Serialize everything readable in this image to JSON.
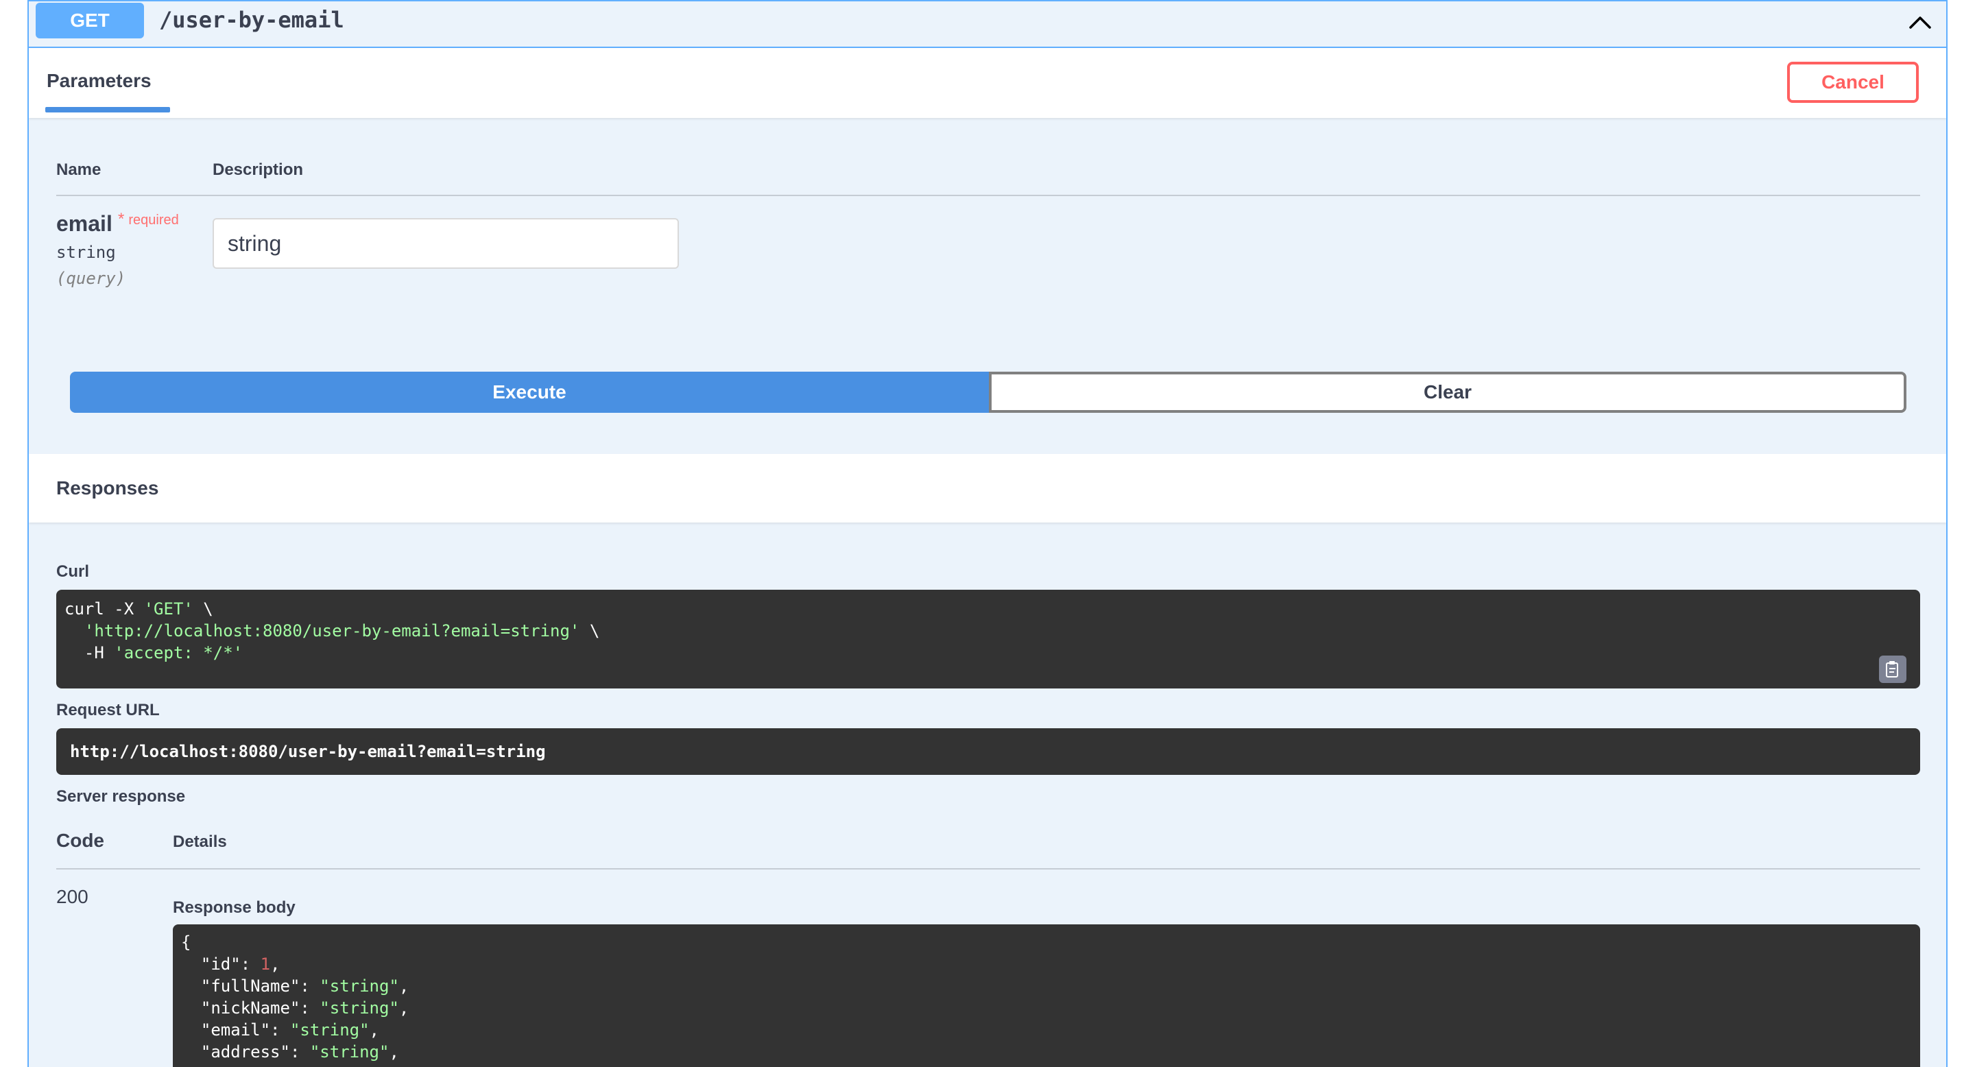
{
  "summary": {
    "method": "GET",
    "path": "/user-by-email",
    "collapse_icon": "chevron-up-icon"
  },
  "parameters": {
    "tab_label": "Parameters",
    "cancel_label": "Cancel",
    "col_name": "Name",
    "col_description": "Description",
    "param": {
      "name": "email",
      "required_mark": "*",
      "required_label": "required",
      "type": "string",
      "in": "(query)",
      "value": "string"
    },
    "execute_label": "Execute",
    "clear_label": "Clear"
  },
  "responses": {
    "title": "Responses",
    "curl_label": "Curl",
    "curl_lines": [
      {
        "plain": "curl -X ",
        "str": "'GET'",
        "tail": " \\"
      },
      {
        "plain": "  ",
        "str": "'http://localhost:8080/user-by-email?email=string'",
        "tail": " \\"
      },
      {
        "plain": "  -H ",
        "str": "'accept: */*'",
        "tail": ""
      }
    ],
    "copy_icon": "clipboard-icon",
    "request_url_label": "Request URL",
    "request_url": "http://localhost:8080/user-by-email?email=string",
    "server_response_label": "Server response",
    "col_code": "Code",
    "col_details": "Details",
    "status_code": "200",
    "response_body_label": "Response body",
    "body_lines": [
      {
        "plain": "{",
        "val": "",
        "kind": "",
        "tail": ""
      },
      {
        "plain": "  \"id\": ",
        "val": "1",
        "kind": "num",
        "tail": ","
      },
      {
        "plain": "  \"fullName\": ",
        "val": "\"string\"",
        "kind": "str",
        "tail": ","
      },
      {
        "plain": "  \"nickName\": ",
        "val": "\"string\"",
        "kind": "str",
        "tail": ","
      },
      {
        "plain": "  \"email\": ",
        "val": "\"string\"",
        "kind": "str",
        "tail": ","
      },
      {
        "plain": "  \"address\": ",
        "val": "\"string\"",
        "kind": "str",
        "tail": ","
      }
    ]
  },
  "colors": {
    "get_blue": "#61affe",
    "execute_blue": "#4990e2",
    "cancel_red": "#ff6060",
    "code_bg": "#333333",
    "string_green": "#a2fca2",
    "number_red": "#d36363"
  }
}
